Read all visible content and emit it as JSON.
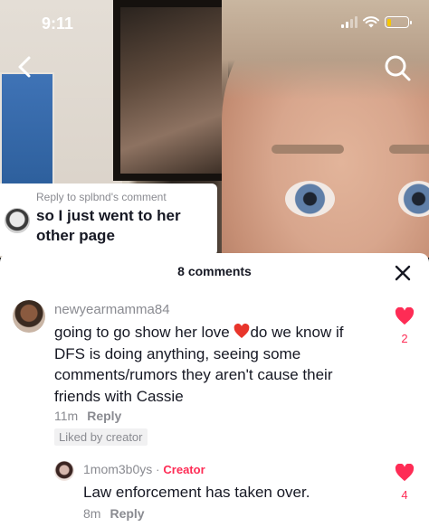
{
  "status_bar": {
    "time": "9:11"
  },
  "reply_bubble": {
    "header": "Reply to splbnd's comment",
    "line1": "so I just went to her",
    "line2": "other page"
  },
  "sheet": {
    "title": "8 comments"
  },
  "comments": [
    {
      "username": "newyearmamma84",
      "text_before_emoji": "going to go show her love ",
      "text_line1_after": "do we know if",
      "text_line2": "DFS is doing anything, seeing some",
      "text_line3": "comments/rumors they aren't cause their",
      "text_line4": "friends with Cassie",
      "time": "11m",
      "reply_label": "Reply",
      "liked_by_creator": "Liked by creator",
      "likes": "2"
    },
    {
      "username": "1mom3b0ys",
      "separator": "·",
      "badge": "Creator",
      "text": "Law enforcement has taken over.",
      "time": "8m",
      "reply_label": "Reply",
      "likes": "4"
    }
  ],
  "colors": {
    "accent": "#fe2c55",
    "secondary_text": "#8a8b91",
    "primary_text": "#161823"
  },
  "icons": [
    "back-arrow-icon",
    "search-icon",
    "close-icon",
    "heart-icon",
    "heart-emoji-icon",
    "wifi-icon",
    "cellular-signal-icon",
    "battery-icon"
  ]
}
